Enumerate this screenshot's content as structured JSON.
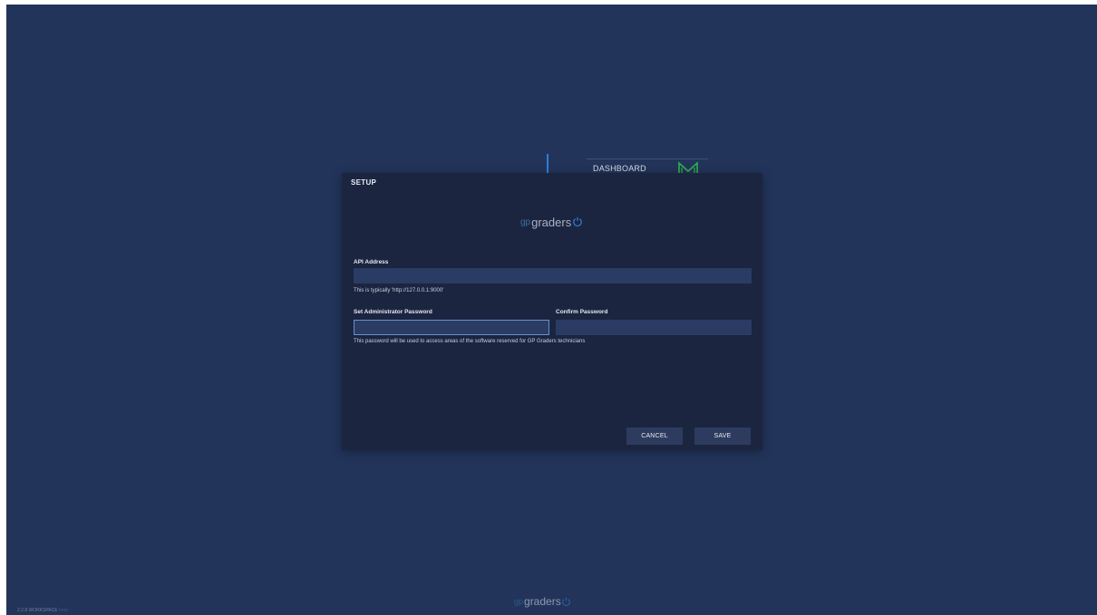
{
  "background": {
    "nav_label": "DASHBOARD",
    "nav_icon": "dashboard-m-icon",
    "nav_icon_color": "#2fb34a"
  },
  "modal": {
    "title": "SETUP",
    "logo": {
      "prefix": "gp",
      "text": "graders",
      "icon": "power-icon"
    },
    "api": {
      "label": "API Address",
      "value": "",
      "hint": "This is typically 'http://127.0.0.1:9000'"
    },
    "admin_password": {
      "label": "Set Administrator Password",
      "value": ""
    },
    "confirm_password": {
      "label": "Confirm Password",
      "value": ""
    },
    "password_hint": "This password will be used to access areas of the software reserved for GP Graders technicians",
    "buttons": {
      "cancel": "CANCEL",
      "save": "SAVE"
    }
  },
  "footer": {
    "logo": {
      "prefix": "gp",
      "text": "graders",
      "icon": "power-icon"
    },
    "version": "2.2.8 WORKSPACE",
    "version_suffix": "beta"
  },
  "colors": {
    "app_background": "#22345a",
    "modal_background": "#1b2540",
    "input_background": "#2a3c63",
    "focus_border": "#6790c9",
    "button_background": "#2d3b5e",
    "accent_blue": "#2f7fd6"
  }
}
